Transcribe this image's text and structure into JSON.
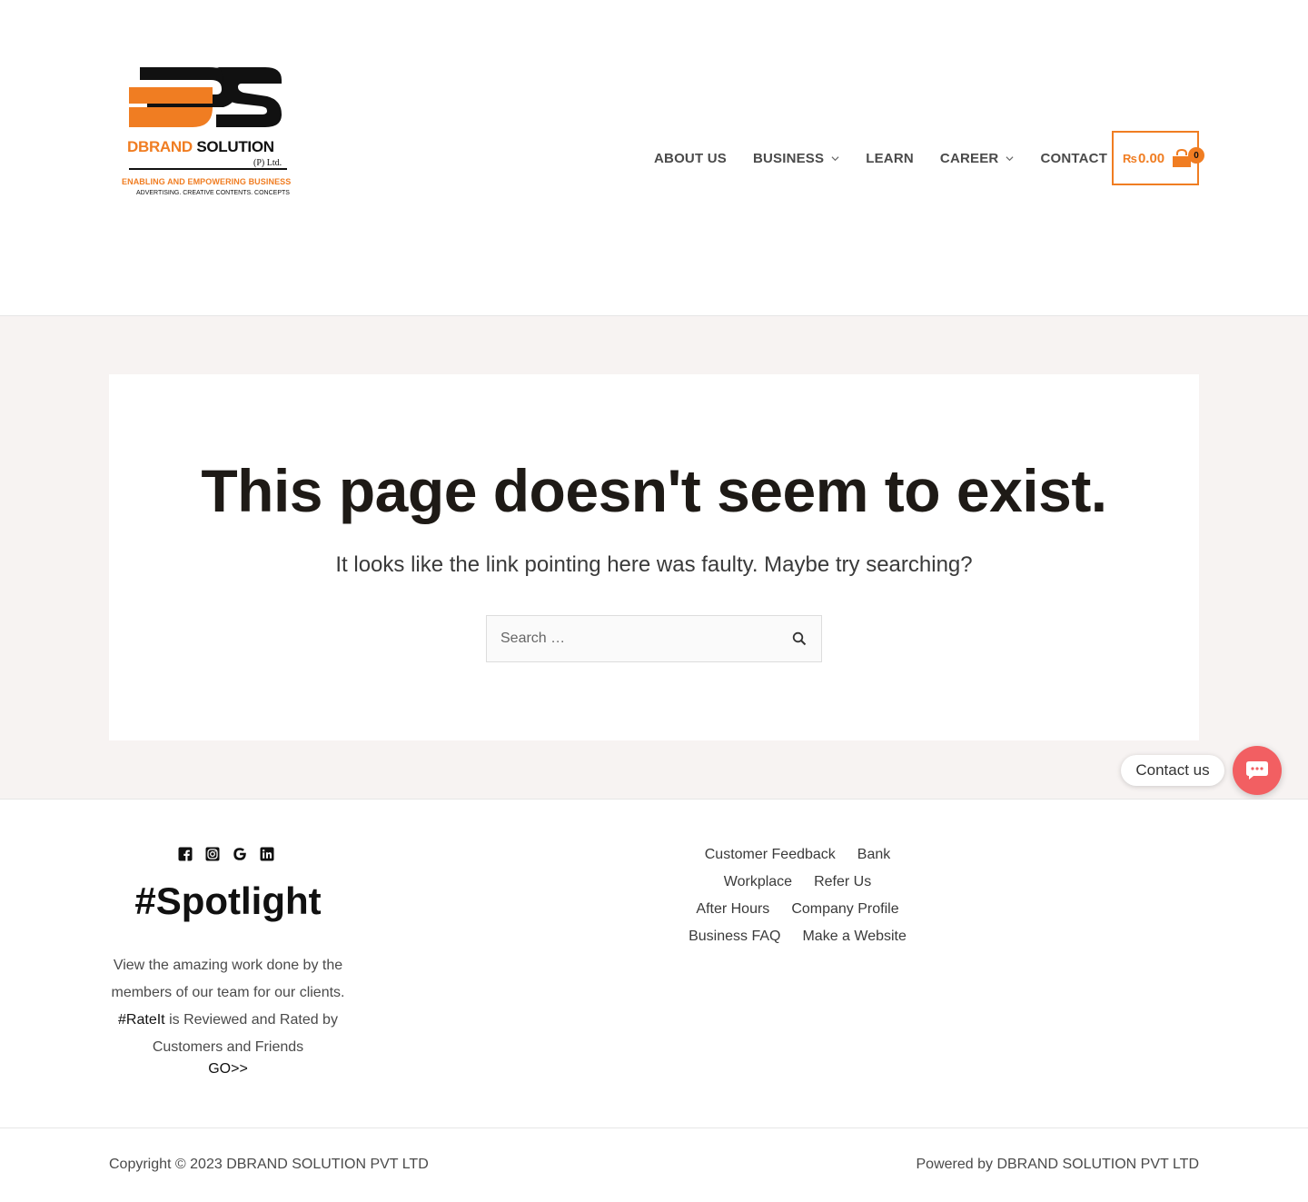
{
  "brand": {
    "logo_word_orange": "DBRAND",
    "logo_word_black": "SOLUTION",
    "logo_suffix": "(P) Ltd.",
    "logo_tagline": "ENABLING AND EMPOWERING BUSINESS",
    "logo_subtagline": "ADVERTISING. CREATIVE CONTENTS. CONCEPTS",
    "accent_color": "#f07d22"
  },
  "nav": {
    "items": [
      {
        "label": "ABOUT US",
        "has_dropdown": false
      },
      {
        "label": "BUSINESS",
        "has_dropdown": true
      },
      {
        "label": "LEARN",
        "has_dropdown": false
      },
      {
        "label": "CAREER",
        "has_dropdown": true
      },
      {
        "label": "CONTACT",
        "has_dropdown": false
      }
    ]
  },
  "cart": {
    "currency": "₨",
    "total": "0.00",
    "count": "0"
  },
  "error": {
    "title": "This page doesn't seem to exist.",
    "subtitle": "It looks like the link pointing here was faulty. Maybe try searching?",
    "search_placeholder": "Search …"
  },
  "contact_widget": {
    "label": "Contact us",
    "color": "#f25f62"
  },
  "footer": {
    "social_icons": [
      "facebook-icon",
      "instagram-icon",
      "google-icon",
      "linkedin-icon"
    ],
    "spotlight_title": "#Spotlight",
    "spotlight_text": "View the amazing work done by the members of our team for our clients.",
    "rateit_link": "#RateIt",
    "rateit_text": " is Reviewed and Rated by Customers and Friends",
    "go_link": "GO>>",
    "links": [
      [
        "Customer Feedback",
        "Bank"
      ],
      [
        "Workplace",
        "Refer Us"
      ],
      [
        "After Hours",
        "Company Profile"
      ],
      [
        "Business FAQ",
        "Make a Website"
      ]
    ]
  },
  "bottom_bar": {
    "copyright": "Copyright © 2023 DBRAND SOLUTION PVT LTD",
    "powered": "Powered by DBRAND SOLUTION PVT LTD"
  }
}
